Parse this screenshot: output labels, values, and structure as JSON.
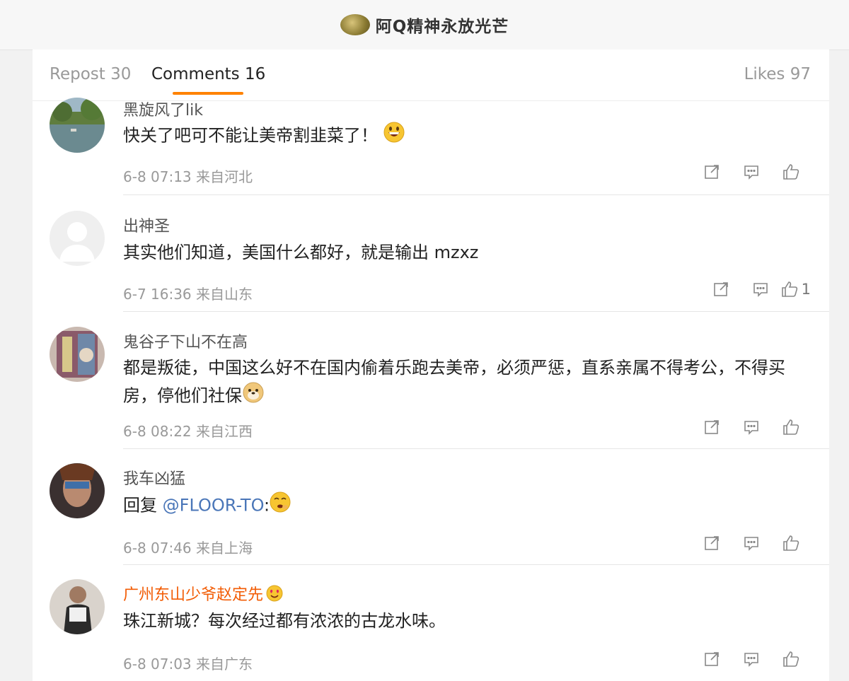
{
  "header": {
    "title": "阿Q精神永放光芒"
  },
  "tabs": {
    "repost": "Repost 30",
    "comments": "Comments 16",
    "likes": "Likes 97"
  },
  "colors": {
    "accent": "#ff8200",
    "mention": "#4a76b8",
    "vip_name": "#f25c05"
  },
  "comments": [
    {
      "user": "黑旋风了lik",
      "text": "快关了吧可不能让美帝割韭菜了！",
      "emoji": "grinning-face",
      "time": "6-8 07:13",
      "location": "来自河北",
      "likes": ""
    },
    {
      "user": "出神圣",
      "text": "其实他们知道，美国什么都好，就是输出 mzxz",
      "time": "6-7 16:36",
      "location": "来自山东",
      "likes": "1"
    },
    {
      "user": "鬼谷子下山不在高",
      "text": "都是叛徒，中国这么好不在国内偷着乐跑去美帝，必须严惩，直系亲属不得考公，不得买房，停他们社保",
      "emoji": "doge",
      "time": "6-8 08:22",
      "location": "来自江西",
      "likes": ""
    },
    {
      "user": "我车凶猛",
      "reply_prefix": "回复",
      "mention": "@FLOOR-TO",
      "colon": ":",
      "emoji": "giggle-face",
      "time": "6-8 07:46",
      "location": "来自上海",
      "likes": ""
    },
    {
      "user": "广州东山少爷赵定先",
      "badge": "heart-eyes-icon",
      "text": "珠江新城？每次经过都有浓浓的古龙水味。",
      "time": "6-8 07:03",
      "location": "来自广东",
      "likes": ""
    }
  ]
}
